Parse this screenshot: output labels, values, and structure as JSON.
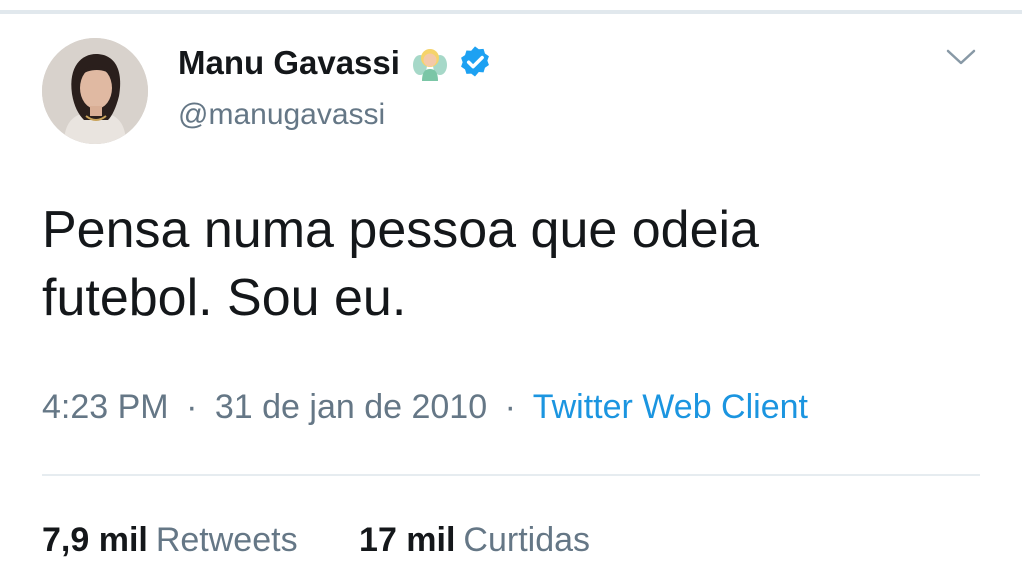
{
  "tweet": {
    "author": {
      "display_name": "Manu Gavassi",
      "handle": "@manugavassi",
      "name_emoji": "fairy-emoji-icon",
      "verified": true
    },
    "text": "Pensa numa pessoa que odeia futebol. Sou eu.",
    "meta": {
      "time": "4:23 PM",
      "separator": "·",
      "date": "31 de jan de 2010",
      "source": "Twitter Web Client"
    },
    "stats": [
      {
        "count": "7,9 mil",
        "label": "Retweets"
      },
      {
        "count": "17 mil",
        "label": "Curtidas"
      }
    ]
  },
  "colors": {
    "text_primary": "#14171a",
    "text_secondary": "#657786",
    "link": "#1b95e0",
    "verified": "#1da1f2",
    "divider": "#e6ecf0"
  }
}
